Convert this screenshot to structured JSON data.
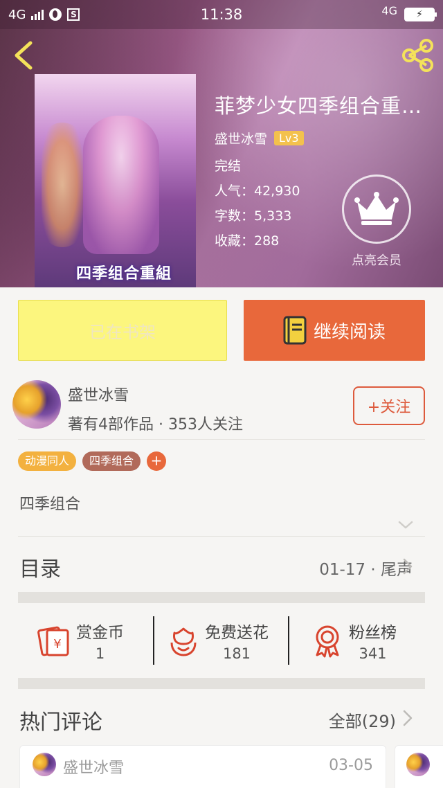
{
  "status_bar": {
    "network_left": "4G",
    "time": "11:38",
    "network_right": "4G",
    "sim_icon": "S",
    "icons": [
      "signal-icon",
      "globe-icon",
      "sim-icon",
      "battery-charging-icon"
    ]
  },
  "header": {
    "back_icon": "chevron-left-icon",
    "share_icon": "share-icon"
  },
  "book": {
    "cover_caption": "四季组合重組",
    "title": "菲梦少女四季组合重…",
    "author": "盛世冰雪",
    "level": "Lv3",
    "status": "完结",
    "popularity": "人气：42,930",
    "word_count": "字数：5,333",
    "favorites": "收藏：288",
    "vip_label": "点亮会员"
  },
  "actions": {
    "shelf_label": "已在书架",
    "read_label": "继续阅读"
  },
  "author": {
    "name": "盛世冰雪",
    "stats": "著有4部作品 · 353人关注",
    "follow_label": "+关注"
  },
  "tags": {
    "items": [
      {
        "label": "动漫同人",
        "color": "#f3b13f"
      },
      {
        "label": "四季组合",
        "color": "#b16a5a"
      }
    ],
    "add_label": "+"
  },
  "intro": "四季组合",
  "catalog": {
    "title": "目录",
    "latest": "01-17 · 尾声"
  },
  "stats": [
    {
      "label": "赏金币",
      "value": "1",
      "icon": "red-envelope-yen-icon"
    },
    {
      "label": "免费送花",
      "value": "181",
      "icon": "flower-smile-icon"
    },
    {
      "label": "粉丝榜",
      "value": "341",
      "icon": "medal-ribbon-icon"
    }
  ],
  "comments": {
    "title": "热门评论",
    "all_label": "全部(29)",
    "first": {
      "user": "盛世冰雪",
      "date": "03-05"
    }
  },
  "colors": {
    "accent_orange": "#e8683b",
    "shelf_yellow": "#fcf67e",
    "follow_red": "#dd5a3c",
    "level_gold": "#f3c14d"
  }
}
